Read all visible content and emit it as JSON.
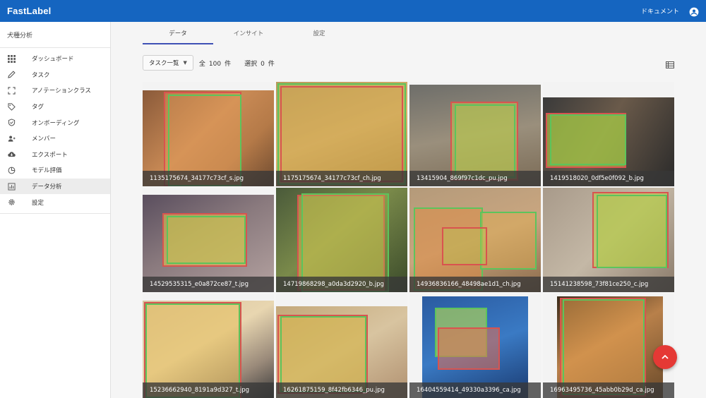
{
  "app": {
    "brand": "FastLabel",
    "docs_link": "ドキュメント"
  },
  "sidebar": {
    "project_title": "犬種分析",
    "items": [
      {
        "label": "ダッシュボード",
        "icon": "grid-icon"
      },
      {
        "label": "タスク",
        "icon": "pencil-icon"
      },
      {
        "label": "アノテーションクラス",
        "icon": "crop-frame-icon"
      },
      {
        "label": "タグ",
        "icon": "tag-icon"
      },
      {
        "label": "オンボーディング",
        "icon": "shield-check-icon"
      },
      {
        "label": "メンバー",
        "icon": "members-icon"
      },
      {
        "label": "エクスポート",
        "icon": "cloud-download-icon"
      },
      {
        "label": "モデル評価",
        "icon": "pie-chart-icon"
      },
      {
        "label": "データ分析",
        "icon": "bar-chart-icon",
        "active": true
      },
      {
        "label": "設定",
        "icon": "gear-icon"
      }
    ]
  },
  "tabs": [
    {
      "label": "データ",
      "active": true
    },
    {
      "label": "インサイト"
    },
    {
      "label": "設定"
    }
  ],
  "toolbar": {
    "task_filter": "タスク一覧",
    "total_prefix": "全",
    "total_count": "100",
    "total_suffix": "件",
    "selected_prefix": "選択",
    "selected_count": "0",
    "selected_suffix": "件"
  },
  "images": [
    {
      "filename": "1135175674_34177c73cf_s.jpg"
    },
    {
      "filename": "1175175674_34177c73cf_ch.jpg"
    },
    {
      "filename": "13415904_869f97c1dc_pu.jpg"
    },
    {
      "filename": "1419518020_0df5e0f092_b.jpg"
    },
    {
      "filename": "14529535315_e0a872ce87_t.jpg"
    },
    {
      "filename": "14719868298_a0da3d2920_b.jpg"
    },
    {
      "filename": "14936836166_48498ae1d1_ch.jpg"
    },
    {
      "filename": "15141238598_73f81ce250_c.jpg"
    },
    {
      "filename": "15236662940_8191a9d327_t.jpg"
    },
    {
      "filename": "16261875159_8f42fb6346_pu.jpg"
    },
    {
      "filename": "16404559414_49330a3396_ca.jpg"
    },
    {
      "filename": "16963495736_45abb0b29d_ca.jpg"
    }
  ],
  "colors": {
    "appbar": "#1565c0",
    "tab_indicator": "#3f51b5",
    "fab": "#e53935",
    "overlay_orange": "#e0a060",
    "overlay_green": "#a8d45a",
    "bbox_red": "#d9534f",
    "bbox_green": "#5cc45c"
  }
}
